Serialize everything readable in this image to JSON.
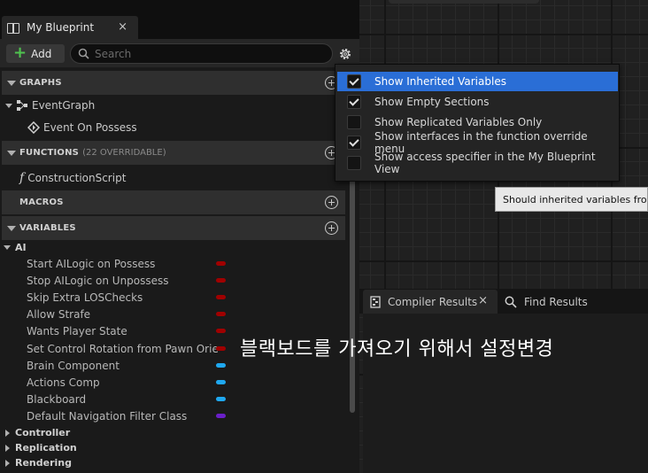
{
  "tab": {
    "title": "My Blueprint",
    "close": "×"
  },
  "toolbar": {
    "add_label": "Add",
    "search_placeholder": "Search"
  },
  "sections": {
    "graphs": {
      "label": "GRAPHS"
    },
    "functions": {
      "label": "FUNCTIONS",
      "sub": "(22 OVERRIDABLE)"
    },
    "macros": {
      "label": "MACROS"
    },
    "variables": {
      "label": "VARIABLES"
    }
  },
  "graphs_items": {
    "event_graph": "EventGraph",
    "event_on_possess": "Event On Possess"
  },
  "functions_items": {
    "construction_script": "ConstructionScript"
  },
  "variables": {
    "category_ai": "AI",
    "items": [
      {
        "name": "Start AILogic on Possess",
        "color": "#a00000"
      },
      {
        "name": "Stop AILogic on Unpossess",
        "color": "#a00000"
      },
      {
        "name": "Skip Extra LOSChecks",
        "color": "#a00000"
      },
      {
        "name": "Allow Strafe",
        "color": "#a00000"
      },
      {
        "name": "Wants Player State",
        "color": "#a00000"
      },
      {
        "name": "Set Control Rotation from Pawn Orie",
        "color": "#a00000"
      },
      {
        "name": "Brain Component",
        "color": "#1fa8f0"
      },
      {
        "name": "Actions Comp",
        "color": "#1fa8f0"
      },
      {
        "name": "Blackboard",
        "color": "#1fa8f0"
      },
      {
        "name": "Default Navigation Filter Class",
        "color": "#6a1fc8"
      }
    ],
    "collapsed": [
      "Controller",
      "Replication",
      "Rendering"
    ]
  },
  "menu": {
    "items": [
      {
        "label": "Show Inherited Variables",
        "checked": true,
        "highlighted": true
      },
      {
        "label": "Show Empty Sections",
        "checked": true,
        "highlighted": false
      },
      {
        "label": "Show Replicated Variables Only",
        "checked": false,
        "highlighted": false
      },
      {
        "label": "Show interfaces in the function override menu",
        "checked": true,
        "highlighted": false
      },
      {
        "label": "Show access specifier in the My Blueprint View",
        "checked": false,
        "highlighted": false
      }
    ]
  },
  "tooltip": {
    "text": "Should inherited variables from p"
  },
  "bottom_tabs": {
    "compiler_results": "Compiler Results",
    "close": "×",
    "find_results": "Find Results"
  },
  "overlay": {
    "text": "블랙보드를 가져오기 위해서 설정변경"
  }
}
